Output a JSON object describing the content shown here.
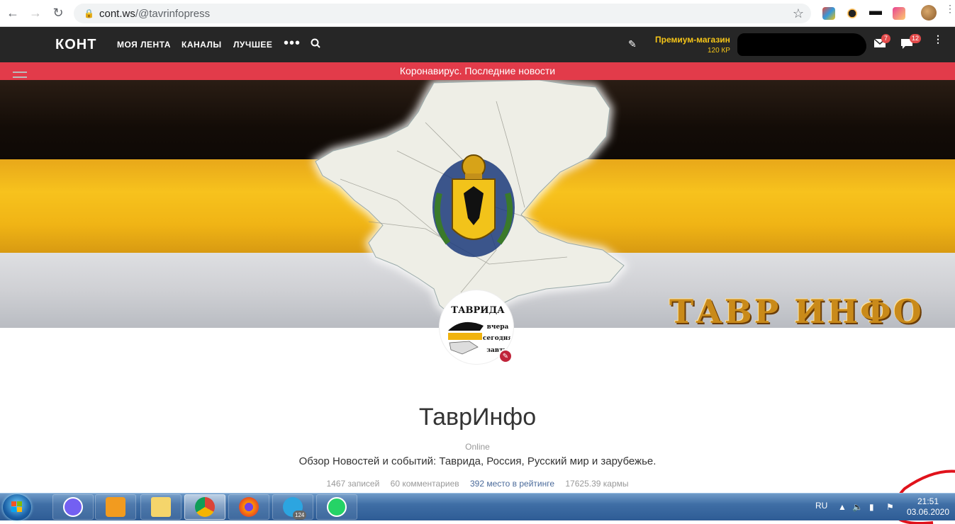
{
  "browser": {
    "url_host": "cont.ws",
    "url_path": "/@tavrinfopress"
  },
  "header": {
    "logo": "КОНТ",
    "nav": [
      "МОЯ ЛЕНТА",
      "КАНАЛЫ",
      "ЛУЧШЕЕ"
    ],
    "premium_label": "Премиум-магазин",
    "premium_sub": "120 КР",
    "mail_count": "7",
    "chat_count": "12"
  },
  "announcement": "Коронавирус. Последние новости",
  "cover": {
    "title_text": "ТАВР ИНФО"
  },
  "avatar": {
    "line1": "ТАВРИДА",
    "line2": "вчера",
    "line3": "сегодня",
    "line4": "завтра"
  },
  "profile": {
    "name": "ТаврИнфо",
    "status": "Online",
    "description": "Обзор Новостей и событий: Таврида, Россия, Русский мир и зарубежье.",
    "posts": "1467 записей",
    "comments": "60 комментариев",
    "rank": "392 место в рейтинге",
    "karma": "17625.39 кармы"
  },
  "taskbar": {
    "lang": "RU",
    "telegram_badge": "124",
    "time": "21:51",
    "date": "03.06.2020"
  },
  "colors": {
    "header_bg": "#262626",
    "announcement_bg": "#e23b4a",
    "premium": "#f5c518",
    "badge": "#e24a4a"
  }
}
